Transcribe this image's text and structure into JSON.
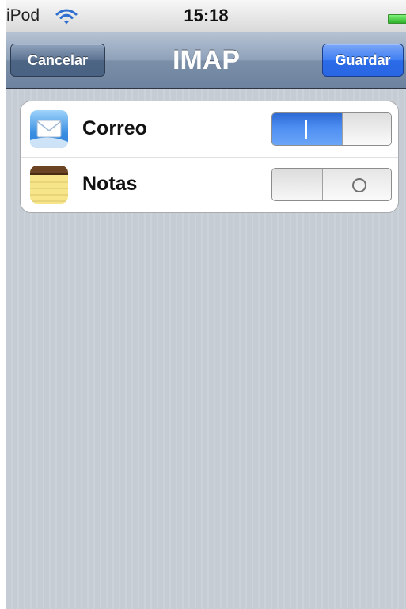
{
  "status_bar": {
    "carrier": "iPod",
    "time": "15:18"
  },
  "nav_bar": {
    "title": "IMAP",
    "cancel_label": "Cancelar",
    "save_label": "Guardar"
  },
  "settings": [
    {
      "label": "Correo",
      "icon": "mail-icon",
      "enabled": true
    },
    {
      "label": "Notas",
      "icon": "notes-icon",
      "enabled": false
    }
  ],
  "colors": {
    "nav_bar": "#8ea1b9",
    "save_button": "#2b6be8",
    "switch_on": "#4e8ef2",
    "background": "#c5ccd4"
  }
}
